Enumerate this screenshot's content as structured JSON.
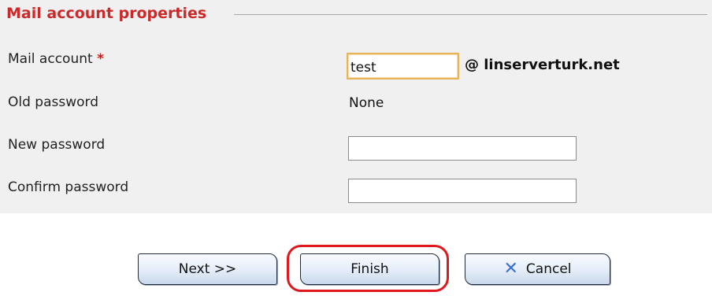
{
  "section": {
    "title": "Mail account properties"
  },
  "fields": {
    "mail_account": {
      "label": "Mail account",
      "required_mark": "*",
      "value": "test",
      "domain": "@ linserverturk.net"
    },
    "old_password": {
      "label": "Old password",
      "value": "None"
    },
    "new_password": {
      "label": "New password",
      "value": ""
    },
    "confirm_password": {
      "label": "Confirm password",
      "value": ""
    }
  },
  "buttons": {
    "next": "Next >>",
    "finish": "Finish",
    "cancel": "Cancel"
  },
  "colors": {
    "section_title": "#cc2a2a",
    "highlight_ring": "#e0181e",
    "cancel_icon": "#3a6fd8"
  },
  "icons": {
    "cancel": "close-x-icon"
  }
}
